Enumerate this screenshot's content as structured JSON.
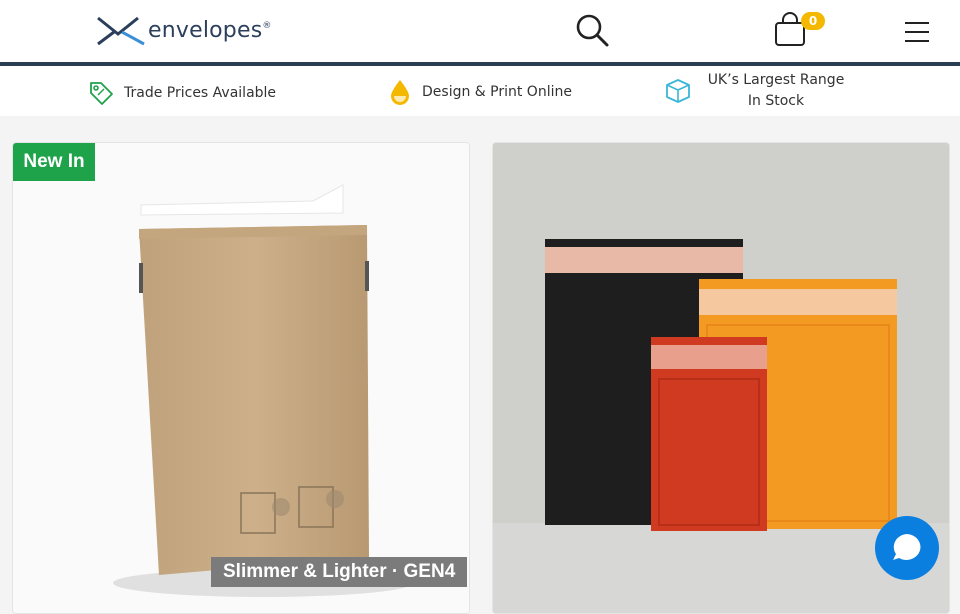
{
  "brand": {
    "name": "envelopes",
    "registered": "®",
    "accent": "#2b3f5c"
  },
  "header": {
    "icons": [
      "envelope-logo-icon",
      "search-icon",
      "shopping-bag-icon",
      "hamburger-menu-icon"
    ],
    "cart_count": "0",
    "cart_badge_color": "#f5b800"
  },
  "usp_bar": {
    "items": [
      {
        "label": "Trade Prices Available",
        "icon": "price-tag-icon"
      },
      {
        "label": "Design & Print Online",
        "icon": "ink-drop-icon"
      },
      {
        "label": "UK’s Largest Range In Stock",
        "icon": "box-icon"
      }
    ]
  },
  "products": [
    {
      "badge": "New In",
      "caption": "Slimmer & Lighter · GEN4",
      "badge_color": "#1fa34a"
    },
    {
      "badge": "",
      "caption": ""
    }
  ],
  "chat": {
    "icon": "chat-bubble-icon",
    "color": "#0a7fe0"
  }
}
